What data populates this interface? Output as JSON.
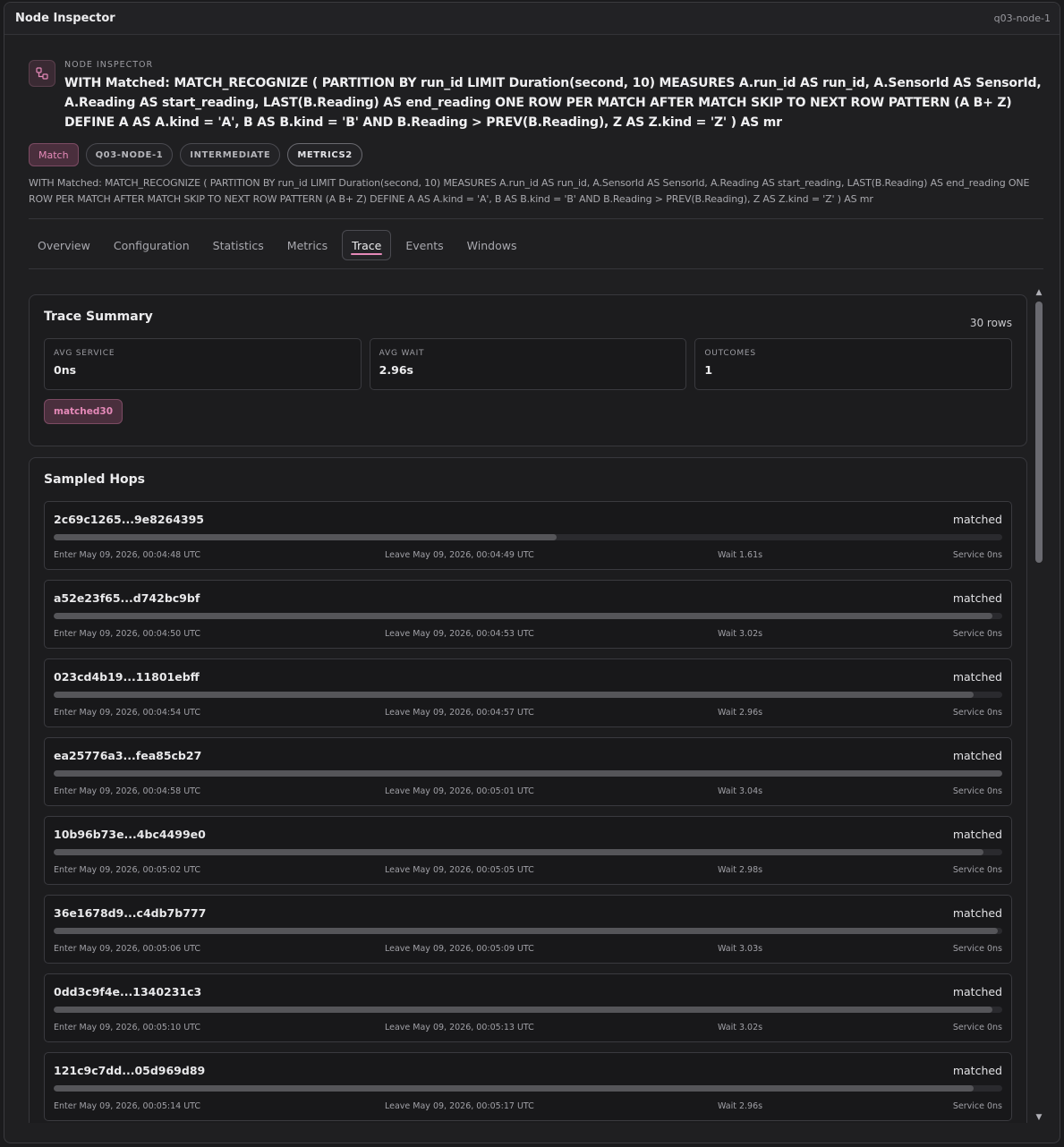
{
  "window": {
    "title": "Node Inspector",
    "node_id": "q03-node-1"
  },
  "header": {
    "eyebrow": "NODE INSPECTOR",
    "icon": "node-graph-icon",
    "query": "WITH Matched: MATCH_RECOGNIZE ( PARTITION BY run_id LIMIT Duration(second, 10) MEASURES A.run_id AS run_id, A.SensorId AS SensorId, A.Reading AS start_reading, LAST(B.Reading) AS end_reading ONE ROW PER MATCH AFTER MATCH SKIP TO NEXT ROW PATTERN (A B+ Z) DEFINE A AS A.kind = 'A', B AS B.kind = 'B' AND B.Reading > PREV(B.Reading), Z AS Z.kind = 'Z' ) AS mr",
    "badges": [
      "Match",
      "Q03-NODE-1",
      "INTERMEDIATE",
      "METRICS2"
    ],
    "description": "WITH Matched: MATCH_RECOGNIZE ( PARTITION BY run_id LIMIT Duration(second, 10) MEASURES A.run_id AS run_id, A.SensorId AS SensorId, A.Reading AS start_reading, LAST(B.Reading) AS end_reading ONE ROW PER MATCH AFTER MATCH SKIP TO NEXT ROW PATTERN (A B+ Z) DEFINE A AS A.kind = 'A', B AS B.kind = 'B' AND B.Reading > PREV(B.Reading), Z AS Z.kind = 'Z' ) AS mr"
  },
  "tabs": [
    "Overview",
    "Configuration",
    "Statistics",
    "Metrics",
    "Trace",
    "Events",
    "Windows"
  ],
  "active_tab": "Trace",
  "trace_summary": {
    "title": "Trace Summary",
    "rows": "30 rows",
    "stats": [
      {
        "label": "AVG SERVICE",
        "value": "0ns"
      },
      {
        "label": "AVG WAIT",
        "value": "2.96s"
      },
      {
        "label": "OUTCOMES",
        "value": "1"
      }
    ],
    "outcome_pill": "matched30"
  },
  "sampled_hops": {
    "title": "Sampled Hops",
    "hops": [
      {
        "id": "2c69c1265...9e8264395",
        "status": "matched",
        "progress": 0.53,
        "enter": "Enter May 09, 2026, 00:04:48 UTC",
        "leave": "Leave May 09, 2026, 00:04:49 UTC",
        "wait": "Wait 1.61s",
        "service": "Service 0ns"
      },
      {
        "id": "a52e23f65...d742bc9bf",
        "status": "matched",
        "progress": 0.99,
        "enter": "Enter May 09, 2026, 00:04:50 UTC",
        "leave": "Leave May 09, 2026, 00:04:53 UTC",
        "wait": "Wait 3.02s",
        "service": "Service 0ns"
      },
      {
        "id": "023cd4b19...11801ebff",
        "status": "matched",
        "progress": 0.97,
        "enter": "Enter May 09, 2026, 00:04:54 UTC",
        "leave": "Leave May 09, 2026, 00:04:57 UTC",
        "wait": "Wait 2.96s",
        "service": "Service 0ns"
      },
      {
        "id": "ea25776a3...fea85cb27",
        "status": "matched",
        "progress": 1.0,
        "enter": "Enter May 09, 2026, 00:04:58 UTC",
        "leave": "Leave May 09, 2026, 00:05:01 UTC",
        "wait": "Wait 3.04s",
        "service": "Service 0ns"
      },
      {
        "id": "10b96b73e...4bc4499e0",
        "status": "matched",
        "progress": 0.98,
        "enter": "Enter May 09, 2026, 00:05:02 UTC",
        "leave": "Leave May 09, 2026, 00:05:05 UTC",
        "wait": "Wait 2.98s",
        "service": "Service 0ns"
      },
      {
        "id": "36e1678d9...c4db7b777",
        "status": "matched",
        "progress": 0.995,
        "enter": "Enter May 09, 2026, 00:05:06 UTC",
        "leave": "Leave May 09, 2026, 00:05:09 UTC",
        "wait": "Wait 3.03s",
        "service": "Service 0ns"
      },
      {
        "id": "0dd3c9f4e...1340231c3",
        "status": "matched",
        "progress": 0.99,
        "enter": "Enter May 09, 2026, 00:05:10 UTC",
        "leave": "Leave May 09, 2026, 00:05:13 UTC",
        "wait": "Wait 3.02s",
        "service": "Service 0ns"
      },
      {
        "id": "121c9c7dd...05d969d89",
        "status": "matched",
        "progress": 0.97,
        "enter": "Enter May 09, 2026, 00:05:14 UTC",
        "leave": "Leave May 09, 2026, 00:05:17 UTC",
        "wait": "Wait 2.96s",
        "service": "Service 0ns"
      }
    ]
  },
  "colors": {
    "accent": "#e589b8",
    "accent_bg": "#4a2f3d",
    "panel": "#1c1c1e",
    "bar_fill": "#555559"
  }
}
